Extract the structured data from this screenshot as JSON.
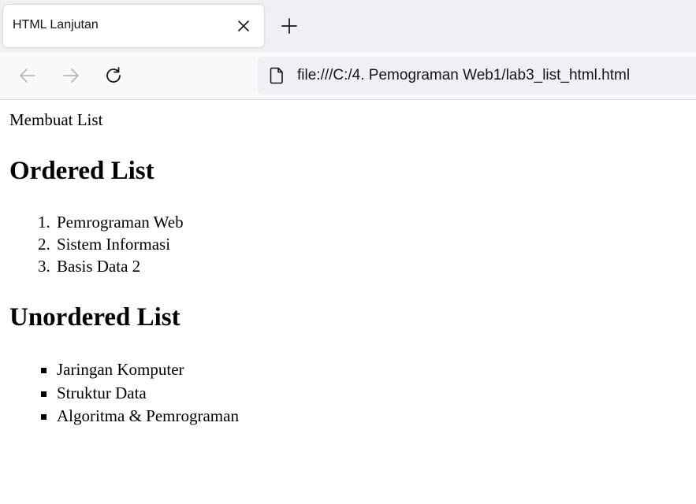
{
  "browser": {
    "tab_title": "HTML Lanjutan",
    "url": "file:///C:/4. Pemograman Web1/lab3_list_html.html",
    "icons": {
      "tab_close": "close-icon",
      "new_tab": "plus-icon",
      "back": "arrow-left-icon",
      "forward": "arrow-right-icon",
      "reload": "reload-icon",
      "page": "file-icon"
    }
  },
  "page": {
    "intro": "Membuat List",
    "ordered": {
      "heading": "Ordered List",
      "items": [
        {
          "num": "1.",
          "label": "Pemrograman Web"
        },
        {
          "num": "2.",
          "label": "Sistem Informasi"
        },
        {
          "num": "3.",
          "label": "Basis Data 2"
        }
      ]
    },
    "unordered": {
      "heading": "Unordered List",
      "items": [
        {
          "label": "Jaringan Komputer"
        },
        {
          "label": "Struktur Data"
        },
        {
          "label": "Algoritma & Pemrograman"
        }
      ]
    }
  }
}
